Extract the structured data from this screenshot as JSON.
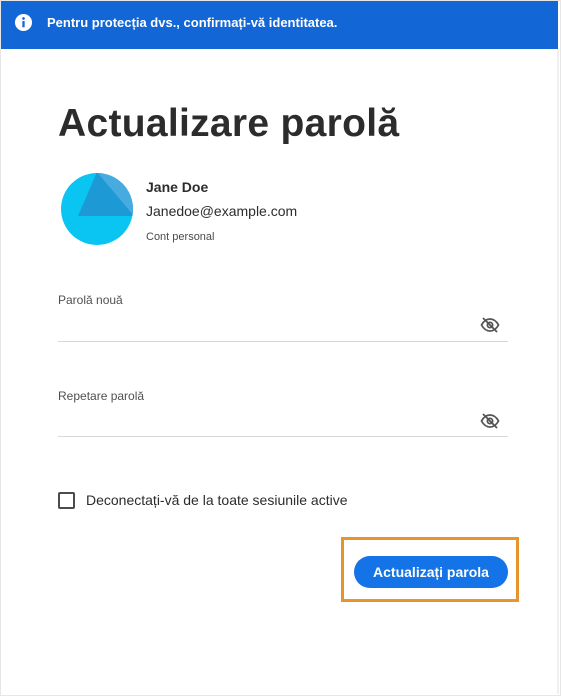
{
  "banner": {
    "text": "Pentru protecția dvs., confirmați-vă identitatea.",
    "icon": "info-icon",
    "color": "#1366d6"
  },
  "page": {
    "title": "Actualizare parolă"
  },
  "user": {
    "name": "Jane Doe",
    "email": "Janedoe@example.com",
    "account_type": "Cont personal",
    "avatar_colors": [
      "#0ac4f2",
      "#1d9ad6",
      "#6ab9e8"
    ]
  },
  "form": {
    "new_password": {
      "label": "Parolă nouă",
      "value": "",
      "visibility_icon": "eye-slash-icon"
    },
    "repeat_password": {
      "label": "Repetare parolă",
      "value": "",
      "visibility_icon": "eye-slash-icon"
    },
    "sign_out_all": {
      "label": "Deconectați-vă de la toate sesiunile active",
      "checked": false
    },
    "submit_label": "Actualizați parola"
  },
  "colors": {
    "primary": "#1473e6",
    "highlight": "#e5952b"
  }
}
